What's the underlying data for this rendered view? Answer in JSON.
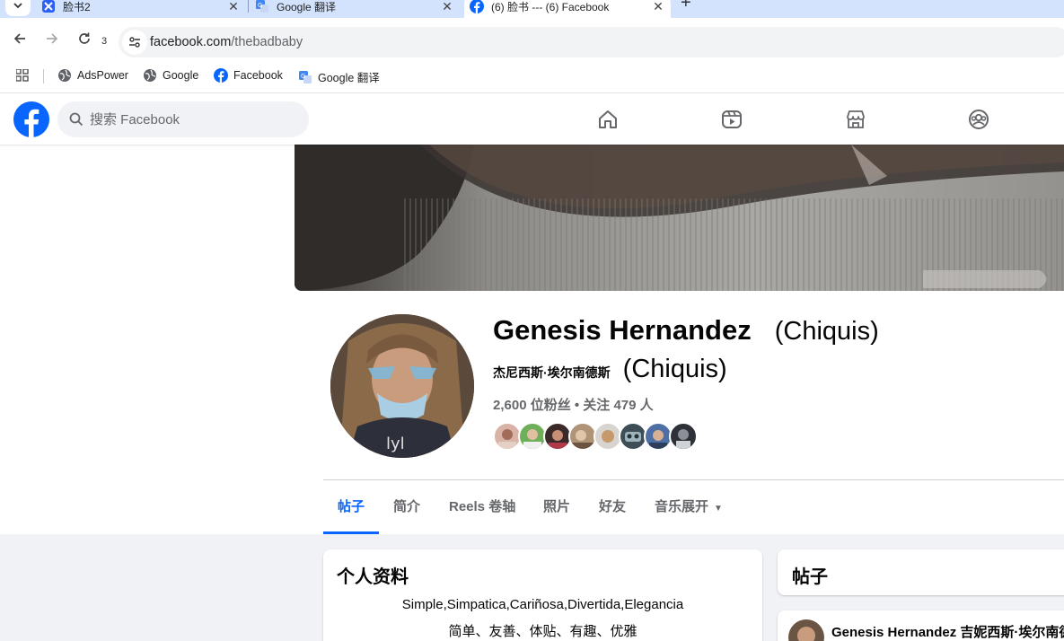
{
  "browser": {
    "tabs": [
      {
        "title": "脸书2",
        "icon": "adspower-icon"
      },
      {
        "title": "Google 翻译",
        "icon": "translate-icon"
      },
      {
        "title": "(6) 脸书 --- (6) Facebook",
        "icon": "facebook-icon",
        "active": true
      }
    ],
    "reload_badge": "3",
    "url_domain": "facebook.com",
    "url_path": "/thebadbaby",
    "bookmarks": [
      {
        "label": "AdsPower",
        "icon": "globe-icon"
      },
      {
        "label": "Google",
        "icon": "globe-icon"
      },
      {
        "label": "Facebook",
        "icon": "facebook-icon"
      },
      {
        "label": "Google 翻译",
        "icon": "translate-icon"
      }
    ]
  },
  "fb": {
    "search_placeholder": "搜索 Facebook",
    "nav_icons": [
      "home-icon",
      "video-icon",
      "marketplace-icon",
      "groups-icon"
    ]
  },
  "profile": {
    "name": "Genesis Hernandez",
    "nickname": "(Chiquis)",
    "alt_name": "杰尼西斯·埃尔南德斯",
    "alt_nickname": "(Chiquis)",
    "stats": "2,600 位粉丝 • 关注 479 人",
    "tabs": [
      "帖子",
      "简介",
      "Reels 卷轴",
      "照片",
      "好友",
      "音乐展开"
    ],
    "active_tab": "帖子"
  },
  "intro": {
    "title": "个人资料",
    "bio_line1": "Simple,Simpatica,Cariñosa,Divertida,Elegancia",
    "bio_line2": "简单、友善、体贴、有趣、优雅"
  },
  "posts": {
    "title": "帖子",
    "author": "Genesis Hernandez 吉妮西斯·埃尔南德斯"
  },
  "colors": {
    "facebook_blue": "#0866ff",
    "secondary_text": "#65676b",
    "page_background": "#f0f2f5",
    "tab_strip": "#d3e3fd"
  }
}
